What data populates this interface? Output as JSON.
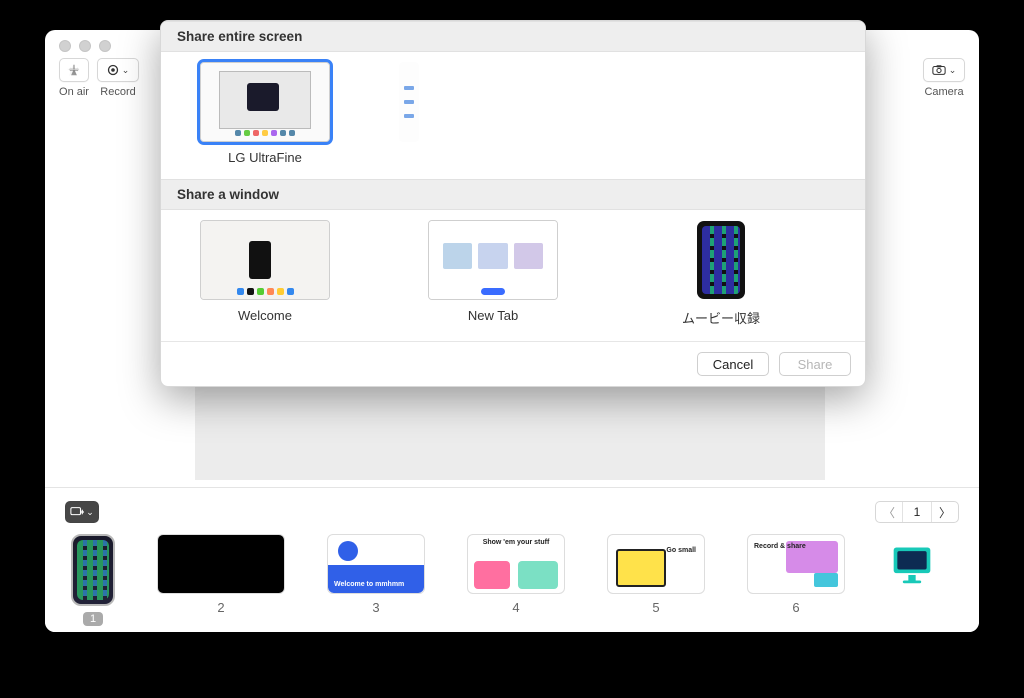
{
  "toolbar": {
    "onair_label": "On air",
    "record_label": "Record",
    "camera_label": "Camera"
  },
  "pager": {
    "current": "1"
  },
  "slides": [
    {
      "num": "1"
    },
    {
      "num": "2"
    },
    {
      "num": "3",
      "caption": "Welcome to mmhmm"
    },
    {
      "num": "4",
      "caption": "Show 'em your stuff"
    },
    {
      "num": "5",
      "caption": "Go small"
    },
    {
      "num": "6",
      "caption": "Record & share"
    }
  ],
  "modal": {
    "section_screen": "Share entire screen",
    "section_window": "Share a window",
    "screens": [
      {
        "label": "LG UltraFine"
      }
    ],
    "windows": [
      {
        "label": "Welcome"
      },
      {
        "label": "New Tab"
      },
      {
        "label": "ムービー収録"
      }
    ],
    "cancel": "Cancel",
    "share": "Share"
  }
}
